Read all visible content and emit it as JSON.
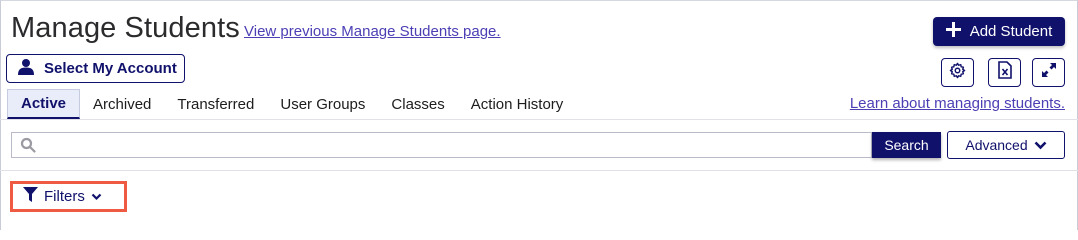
{
  "header": {
    "title": "Manage Students",
    "prev_link": "View previous Manage Students page.",
    "add_button": "Add Student",
    "account_button": "Select My Account"
  },
  "toolbar": {
    "icons": [
      "gear-icon",
      "excel-icon",
      "expand-icon"
    ]
  },
  "tabs": [
    {
      "label": "Active",
      "active": true
    },
    {
      "label": "Archived"
    },
    {
      "label": "Transferred"
    },
    {
      "label": "User Groups"
    },
    {
      "label": "Classes"
    },
    {
      "label": "Action History"
    }
  ],
  "learn_link": "Learn about managing students.",
  "search": {
    "value": "",
    "placeholder": "",
    "button": "Search",
    "advanced": "Advanced"
  },
  "filters": {
    "label": "Filters"
  },
  "colors": {
    "primary": "#10116b",
    "link": "#4b3fb4",
    "highlight": "#ef5a43"
  }
}
